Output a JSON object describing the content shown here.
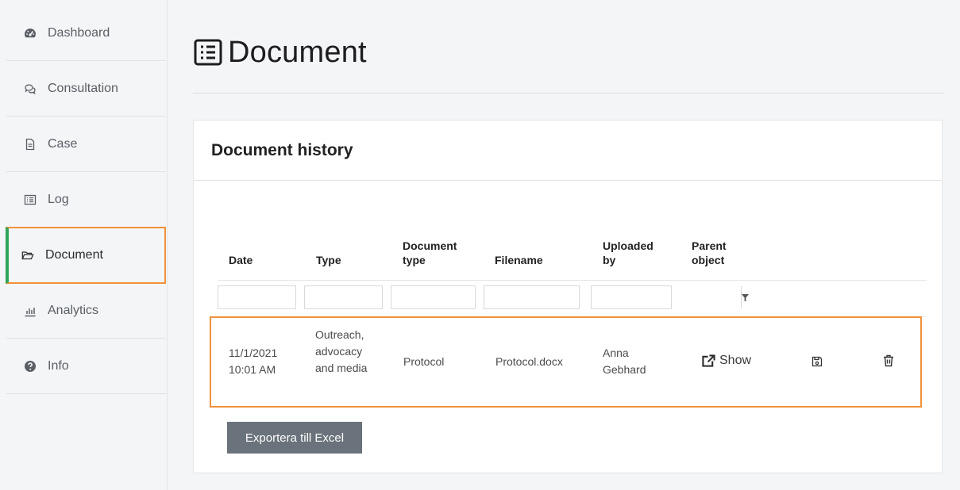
{
  "sidebar": {
    "items": [
      {
        "label": "Dashboard",
        "icon": "speedometer-icon"
      },
      {
        "label": "Consultation",
        "icon": "chat-bubbles-icon"
      },
      {
        "label": "Case",
        "icon": "file-icon"
      },
      {
        "label": "Log",
        "icon": "list-icon"
      },
      {
        "label": "Document",
        "icon": "folder-open-icon",
        "active": true
      },
      {
        "label": "Analytics",
        "icon": "bar-chart-icon"
      },
      {
        "label": "Info",
        "icon": "question-circle-icon"
      }
    ]
  },
  "page": {
    "title": "Document",
    "title_icon": "list-box-icon"
  },
  "card": {
    "title": "Document history",
    "columns": [
      "Date",
      "Type",
      "Document type",
      "Filename",
      "Uploaded by",
      "Parent object"
    ],
    "rows": [
      {
        "date": "11/1/2021 10:01 AM",
        "type": "Outreach, advocacy and media",
        "document_type": "Protocol",
        "filename": "Protocol.docx",
        "uploaded_by": "Anna Gebhard",
        "parent_object_link": "Show"
      }
    ]
  },
  "actions": {
    "export_label": "Exportera till Excel"
  },
  "colors": {
    "highlight": "#f0913a",
    "active_accent": "#2fa55a",
    "button_bg": "#6a737b"
  }
}
